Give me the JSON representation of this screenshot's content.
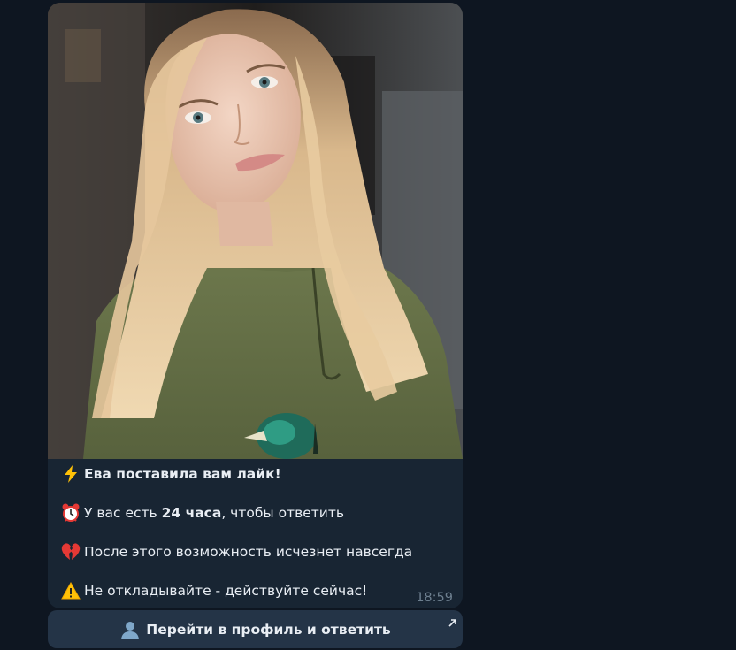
{
  "message": {
    "photo": {
      "icon": "woman-photo"
    },
    "lines": [
      {
        "icon": "lightning-icon",
        "text": "Ева поставила вам лайк!",
        "bold": true
      },
      {
        "icon": "alarm-clock-icon",
        "prefix": "У вас есть ",
        "bold_text": "24 часа",
        "suffix": ", чтобы ответить"
      },
      {
        "icon": "broken-heart-icon",
        "text": "После этого возможность исчезнет навсегда"
      },
      {
        "icon": "warning-icon",
        "text": "Не откладывайте - действуйте сейчас!"
      }
    ],
    "time": "18:59"
  },
  "inline_button": {
    "icon": "bust-silhouette-icon",
    "label": "Перейти в профиль и ответить",
    "corner_icon": "external-link-arrow-icon"
  },
  "colors": {
    "background": "#0e1621",
    "bubble": "#182533",
    "button": "#243447",
    "text": "#e9eef4",
    "time": "#6d7f8f"
  }
}
